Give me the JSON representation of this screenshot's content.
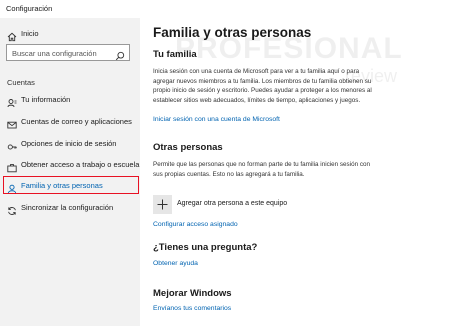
{
  "window": {
    "title": "Configuración"
  },
  "sidebar": {
    "home_label": "Inicio",
    "search_placeholder": "Buscar una configuración",
    "section_label": "Cuentas",
    "items": [
      {
        "label": "Tu información",
        "icon": "user-card-icon"
      },
      {
        "label": "Cuentas de correo y aplicaciones",
        "icon": "mail-icon"
      },
      {
        "label": "Opciones de inicio de sesión",
        "icon": "key-icon"
      },
      {
        "label": "Obtener acceso a trabajo o escuela",
        "icon": "briefcase-icon"
      },
      {
        "label": "Familia y otras personas",
        "icon": "person-icon",
        "active": true
      },
      {
        "label": "Sincronizar la configuración",
        "icon": "sync-icon"
      }
    ]
  },
  "main": {
    "title": "Familia y otras personas",
    "family": {
      "heading": "Tu familia",
      "description": "Inicia sesión con una cuenta de Microsoft para ver a tu familia aquí o para agregar nuevos miembros a tu familia. Los miembros de tu familia obtienen su propio inicio de sesión y escritorio. Puedes ayudar a proteger a los menores al establecer sitios web adecuados, límites de tiempo, aplicaciones y juegos.",
      "link": "Iniciar sesión con una cuenta de Microsoft"
    },
    "others": {
      "heading": "Otras personas",
      "description": "Permite que las personas que no forman parte de tu familia inicien sesión con sus propias cuentas. Esto no las agregará a tu familia.",
      "add_label": "Agregar otra persona a este equipo",
      "link": "Configurar acceso asignado"
    },
    "question": {
      "heading": "¿Tienes una pregunta?",
      "link": "Obtener ayuda"
    },
    "improve": {
      "heading": "Mejorar Windows",
      "link": "Envíanos tus comentarios"
    }
  },
  "watermark": {
    "line1": "PROFESIONAL",
    "line2": "review"
  },
  "colors": {
    "accent": "#0063b1",
    "highlight": "#e81123",
    "sidebar_bg": "#f2f2f2"
  }
}
